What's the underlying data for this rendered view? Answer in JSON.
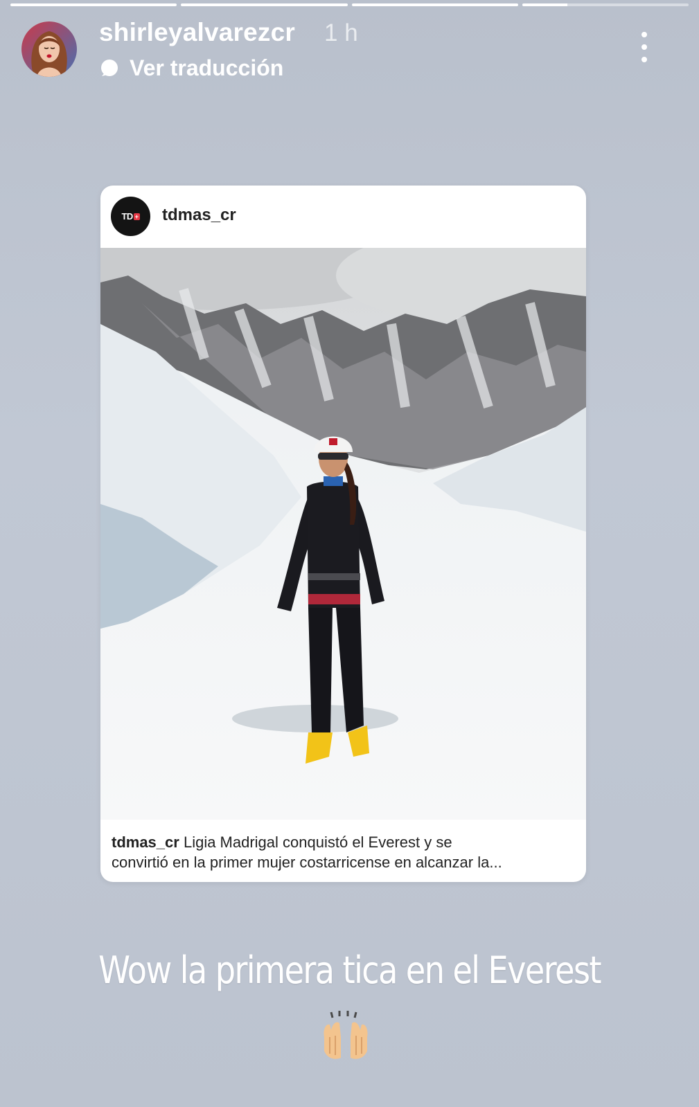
{
  "story": {
    "progress": [
      1,
      1,
      1,
      0.27
    ],
    "username": "shirleyalvarezcr",
    "time": "1 h",
    "translate_label": "Ver traducción",
    "menu_icon": "more-vertical-icon"
  },
  "shared_post": {
    "username": "tdmas_cr",
    "logo_text": "TD",
    "logo_plus": "+",
    "caption_user": "tdmas_cr",
    "caption_line1": " Ligia Madrigal conquistó el Everest y se",
    "caption_line2": "convirtió en la primer mujer costarricense en alcanzar la..."
  },
  "overlay": {
    "text": "Wow la primera tica en el Everest",
    "emoji": "raising-hands-emoji"
  },
  "colors": {
    "background": "#bec5d1",
    "card": "#ffffff",
    "text_light": "#ffffff"
  }
}
